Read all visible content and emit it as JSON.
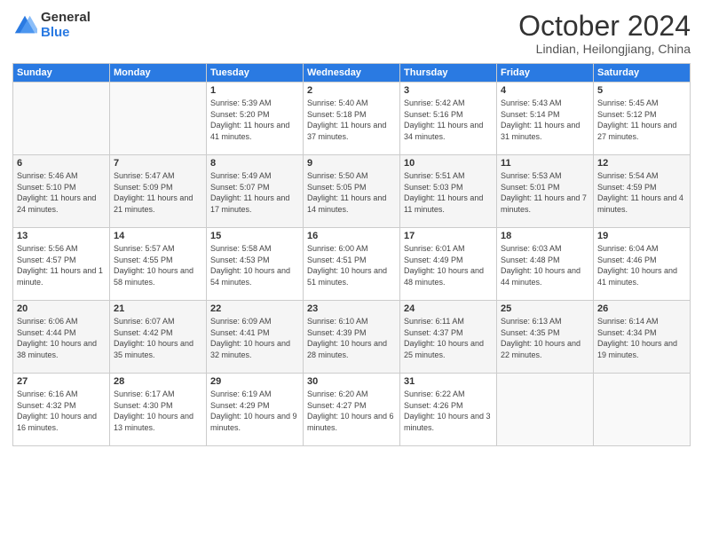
{
  "header": {
    "logo_general": "General",
    "logo_blue": "Blue",
    "month_title": "October 2024",
    "subtitle": "Lindian, Heilongjiang, China"
  },
  "weekdays": [
    "Sunday",
    "Monday",
    "Tuesday",
    "Wednesday",
    "Thursday",
    "Friday",
    "Saturday"
  ],
  "weeks": [
    [
      null,
      null,
      {
        "day": "1",
        "sunrise": "5:39 AM",
        "sunset": "5:20 PM",
        "daylight": "11 hours and 41 minutes."
      },
      {
        "day": "2",
        "sunrise": "5:40 AM",
        "sunset": "5:18 PM",
        "daylight": "11 hours and 37 minutes."
      },
      {
        "day": "3",
        "sunrise": "5:42 AM",
        "sunset": "5:16 PM",
        "daylight": "11 hours and 34 minutes."
      },
      {
        "day": "4",
        "sunrise": "5:43 AM",
        "sunset": "5:14 PM",
        "daylight": "11 hours and 31 minutes."
      },
      {
        "day": "5",
        "sunrise": "5:45 AM",
        "sunset": "5:12 PM",
        "daylight": "11 hours and 27 minutes."
      }
    ],
    [
      {
        "day": "6",
        "sunrise": "5:46 AM",
        "sunset": "5:10 PM",
        "daylight": "11 hours and 24 minutes."
      },
      {
        "day": "7",
        "sunrise": "5:47 AM",
        "sunset": "5:09 PM",
        "daylight": "11 hours and 21 minutes."
      },
      {
        "day": "8",
        "sunrise": "5:49 AM",
        "sunset": "5:07 PM",
        "daylight": "11 hours and 17 minutes."
      },
      {
        "day": "9",
        "sunrise": "5:50 AM",
        "sunset": "5:05 PM",
        "daylight": "11 hours and 14 minutes."
      },
      {
        "day": "10",
        "sunrise": "5:51 AM",
        "sunset": "5:03 PM",
        "daylight": "11 hours and 11 minutes."
      },
      {
        "day": "11",
        "sunrise": "5:53 AM",
        "sunset": "5:01 PM",
        "daylight": "11 hours and 7 minutes."
      },
      {
        "day": "12",
        "sunrise": "5:54 AM",
        "sunset": "4:59 PM",
        "daylight": "11 hours and 4 minutes."
      }
    ],
    [
      {
        "day": "13",
        "sunrise": "5:56 AM",
        "sunset": "4:57 PM",
        "daylight": "11 hours and 1 minute."
      },
      {
        "day": "14",
        "sunrise": "5:57 AM",
        "sunset": "4:55 PM",
        "daylight": "10 hours and 58 minutes."
      },
      {
        "day": "15",
        "sunrise": "5:58 AM",
        "sunset": "4:53 PM",
        "daylight": "10 hours and 54 minutes."
      },
      {
        "day": "16",
        "sunrise": "6:00 AM",
        "sunset": "4:51 PM",
        "daylight": "10 hours and 51 minutes."
      },
      {
        "day": "17",
        "sunrise": "6:01 AM",
        "sunset": "4:49 PM",
        "daylight": "10 hours and 48 minutes."
      },
      {
        "day": "18",
        "sunrise": "6:03 AM",
        "sunset": "4:48 PM",
        "daylight": "10 hours and 44 minutes."
      },
      {
        "day": "19",
        "sunrise": "6:04 AM",
        "sunset": "4:46 PM",
        "daylight": "10 hours and 41 minutes."
      }
    ],
    [
      {
        "day": "20",
        "sunrise": "6:06 AM",
        "sunset": "4:44 PM",
        "daylight": "10 hours and 38 minutes."
      },
      {
        "day": "21",
        "sunrise": "6:07 AM",
        "sunset": "4:42 PM",
        "daylight": "10 hours and 35 minutes."
      },
      {
        "day": "22",
        "sunrise": "6:09 AM",
        "sunset": "4:41 PM",
        "daylight": "10 hours and 32 minutes."
      },
      {
        "day": "23",
        "sunrise": "6:10 AM",
        "sunset": "4:39 PM",
        "daylight": "10 hours and 28 minutes."
      },
      {
        "day": "24",
        "sunrise": "6:11 AM",
        "sunset": "4:37 PM",
        "daylight": "10 hours and 25 minutes."
      },
      {
        "day": "25",
        "sunrise": "6:13 AM",
        "sunset": "4:35 PM",
        "daylight": "10 hours and 22 minutes."
      },
      {
        "day": "26",
        "sunrise": "6:14 AM",
        "sunset": "4:34 PM",
        "daylight": "10 hours and 19 minutes."
      }
    ],
    [
      {
        "day": "27",
        "sunrise": "6:16 AM",
        "sunset": "4:32 PM",
        "daylight": "10 hours and 16 minutes."
      },
      {
        "day": "28",
        "sunrise": "6:17 AM",
        "sunset": "4:30 PM",
        "daylight": "10 hours and 13 minutes."
      },
      {
        "day": "29",
        "sunrise": "6:19 AM",
        "sunset": "4:29 PM",
        "daylight": "10 hours and 9 minutes."
      },
      {
        "day": "30",
        "sunrise": "6:20 AM",
        "sunset": "4:27 PM",
        "daylight": "10 hours and 6 minutes."
      },
      {
        "day": "31",
        "sunrise": "6:22 AM",
        "sunset": "4:26 PM",
        "daylight": "10 hours and 3 minutes."
      },
      null,
      null
    ]
  ],
  "labels": {
    "sunrise": "Sunrise:",
    "sunset": "Sunset:",
    "daylight": "Daylight:"
  }
}
